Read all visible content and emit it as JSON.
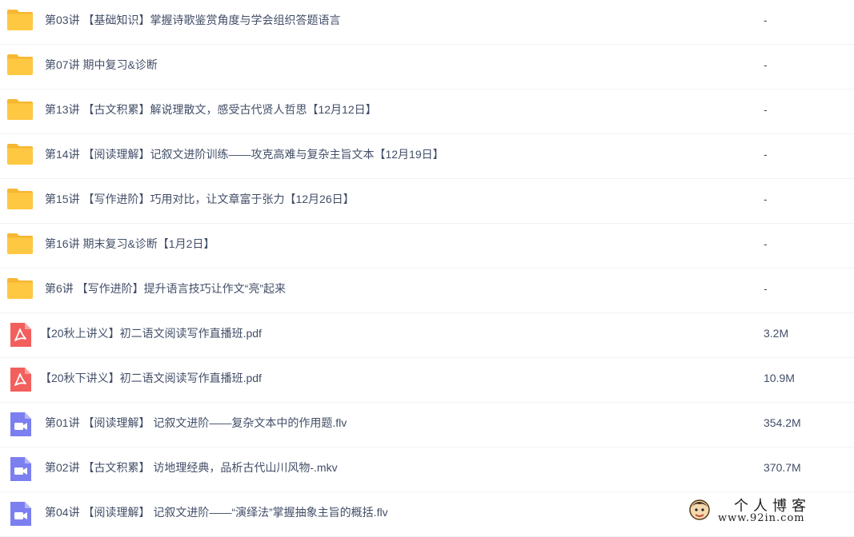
{
  "files": [
    {
      "type": "folder",
      "name": "第03讲 【基础知识】掌握诗歌鉴赏角度与学会组织答题语言",
      "size": "-"
    },
    {
      "type": "folder",
      "name": "第07讲 期中复习&诊断",
      "size": "-"
    },
    {
      "type": "folder",
      "name": "第13讲 【古文积累】解说理散文，感受古代贤人哲思【12月12日】",
      "size": "-"
    },
    {
      "type": "folder",
      "name": "第14讲 【阅读理解】记叙文进阶训练——攻克高难与复杂主旨文本【12月19日】",
      "size": "-"
    },
    {
      "type": "folder",
      "name": "第15讲 【写作进阶】巧用对比，让文章富于张力【12月26日】",
      "size": "-"
    },
    {
      "type": "folder",
      "name": "第16讲 期末复习&诊断【1月2日】",
      "size": "-"
    },
    {
      "type": "folder",
      "name": "第6讲 【写作进阶】提升语言技巧让作文“亮”起来",
      "size": "-"
    },
    {
      "type": "pdf",
      "name": "【20秋上讲义】初二语文阅读写作直播班.pdf",
      "size": "3.2M"
    },
    {
      "type": "pdf",
      "name": "【20秋下讲义】初二语文阅读写作直播班.pdf",
      "size": "10.9M"
    },
    {
      "type": "video",
      "name": "第01讲 【阅读理解】 记叙文进阶——复杂文本中的作用题.flv",
      "size": "354.2M"
    },
    {
      "type": "video",
      "name": "第02讲 【古文积累】 访地理经典，品析古代山川风物-.mkv",
      "size": "370.7M"
    },
    {
      "type": "video",
      "name": "第04讲 【阅读理解】 记叙文进阶——“演绎法”掌握抽象主旨的概括.flv",
      "size": ""
    }
  ],
  "icons": {
    "folder": "folder-icon",
    "pdf": "pdf-icon",
    "video": "video-icon"
  },
  "colors": {
    "folder": "#ffc842",
    "pdf": "#f25f5c",
    "video": "#7b7ff0",
    "text": "#424e67"
  },
  "watermark": {
    "title": "个人博客",
    "url": "www.92in.com"
  }
}
